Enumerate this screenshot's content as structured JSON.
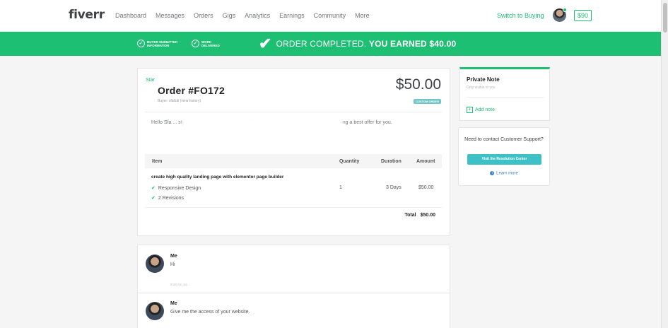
{
  "nav": {
    "logo": "fiverr",
    "links": [
      "Dashboard",
      "Messages",
      "Orders",
      "Gigs",
      "Analytics",
      "Earnings",
      "Community",
      "More"
    ],
    "switch_label": "Switch to Buying",
    "balance": "$90"
  },
  "banner": {
    "step1": "BUYER SUBMITTED INFORMATION",
    "step2": "WORK DELIVERED",
    "prefix": "ORDER COMPLETED.",
    "earned": "YOU EARNED $40.00",
    "color": "#1dbf73"
  },
  "order": {
    "star": "Star",
    "title": "Order #FO172",
    "buyer_line": "Buyer: sfatluti (view history)",
    "price": "$50.00",
    "badge": "CUSTOM ORDER",
    "message": "Hello Sfa ... style form/contact form name, mail and drop ... your website. Here I am giving a best offer for you.",
    "table": {
      "headers": [
        "Item",
        "Quantity",
        "Duration",
        "Amount"
      ],
      "item_title": "create high quality landing page with elementor page builder",
      "features": [
        "Responsive Design",
        "2 Revisions"
      ],
      "quantity": "1",
      "duration": "3 Days",
      "amount": "$50.00",
      "total_label": "Total",
      "total_value": "$50.00"
    }
  },
  "sidebar": {
    "note_title": "Private Note",
    "note_sub": "Only visible to you",
    "add_note": "Add note",
    "support_text": "Need to contact Customer Support?",
    "resolution_button": "Visit the Resolution Center",
    "learn_more": "Learn more"
  },
  "chat": [
    {
      "name": "Me",
      "text": "Hi",
      "time": "9:28 Am Jul..."
    },
    {
      "name": "Me",
      "text": "Give me the access of your website."
    }
  ]
}
